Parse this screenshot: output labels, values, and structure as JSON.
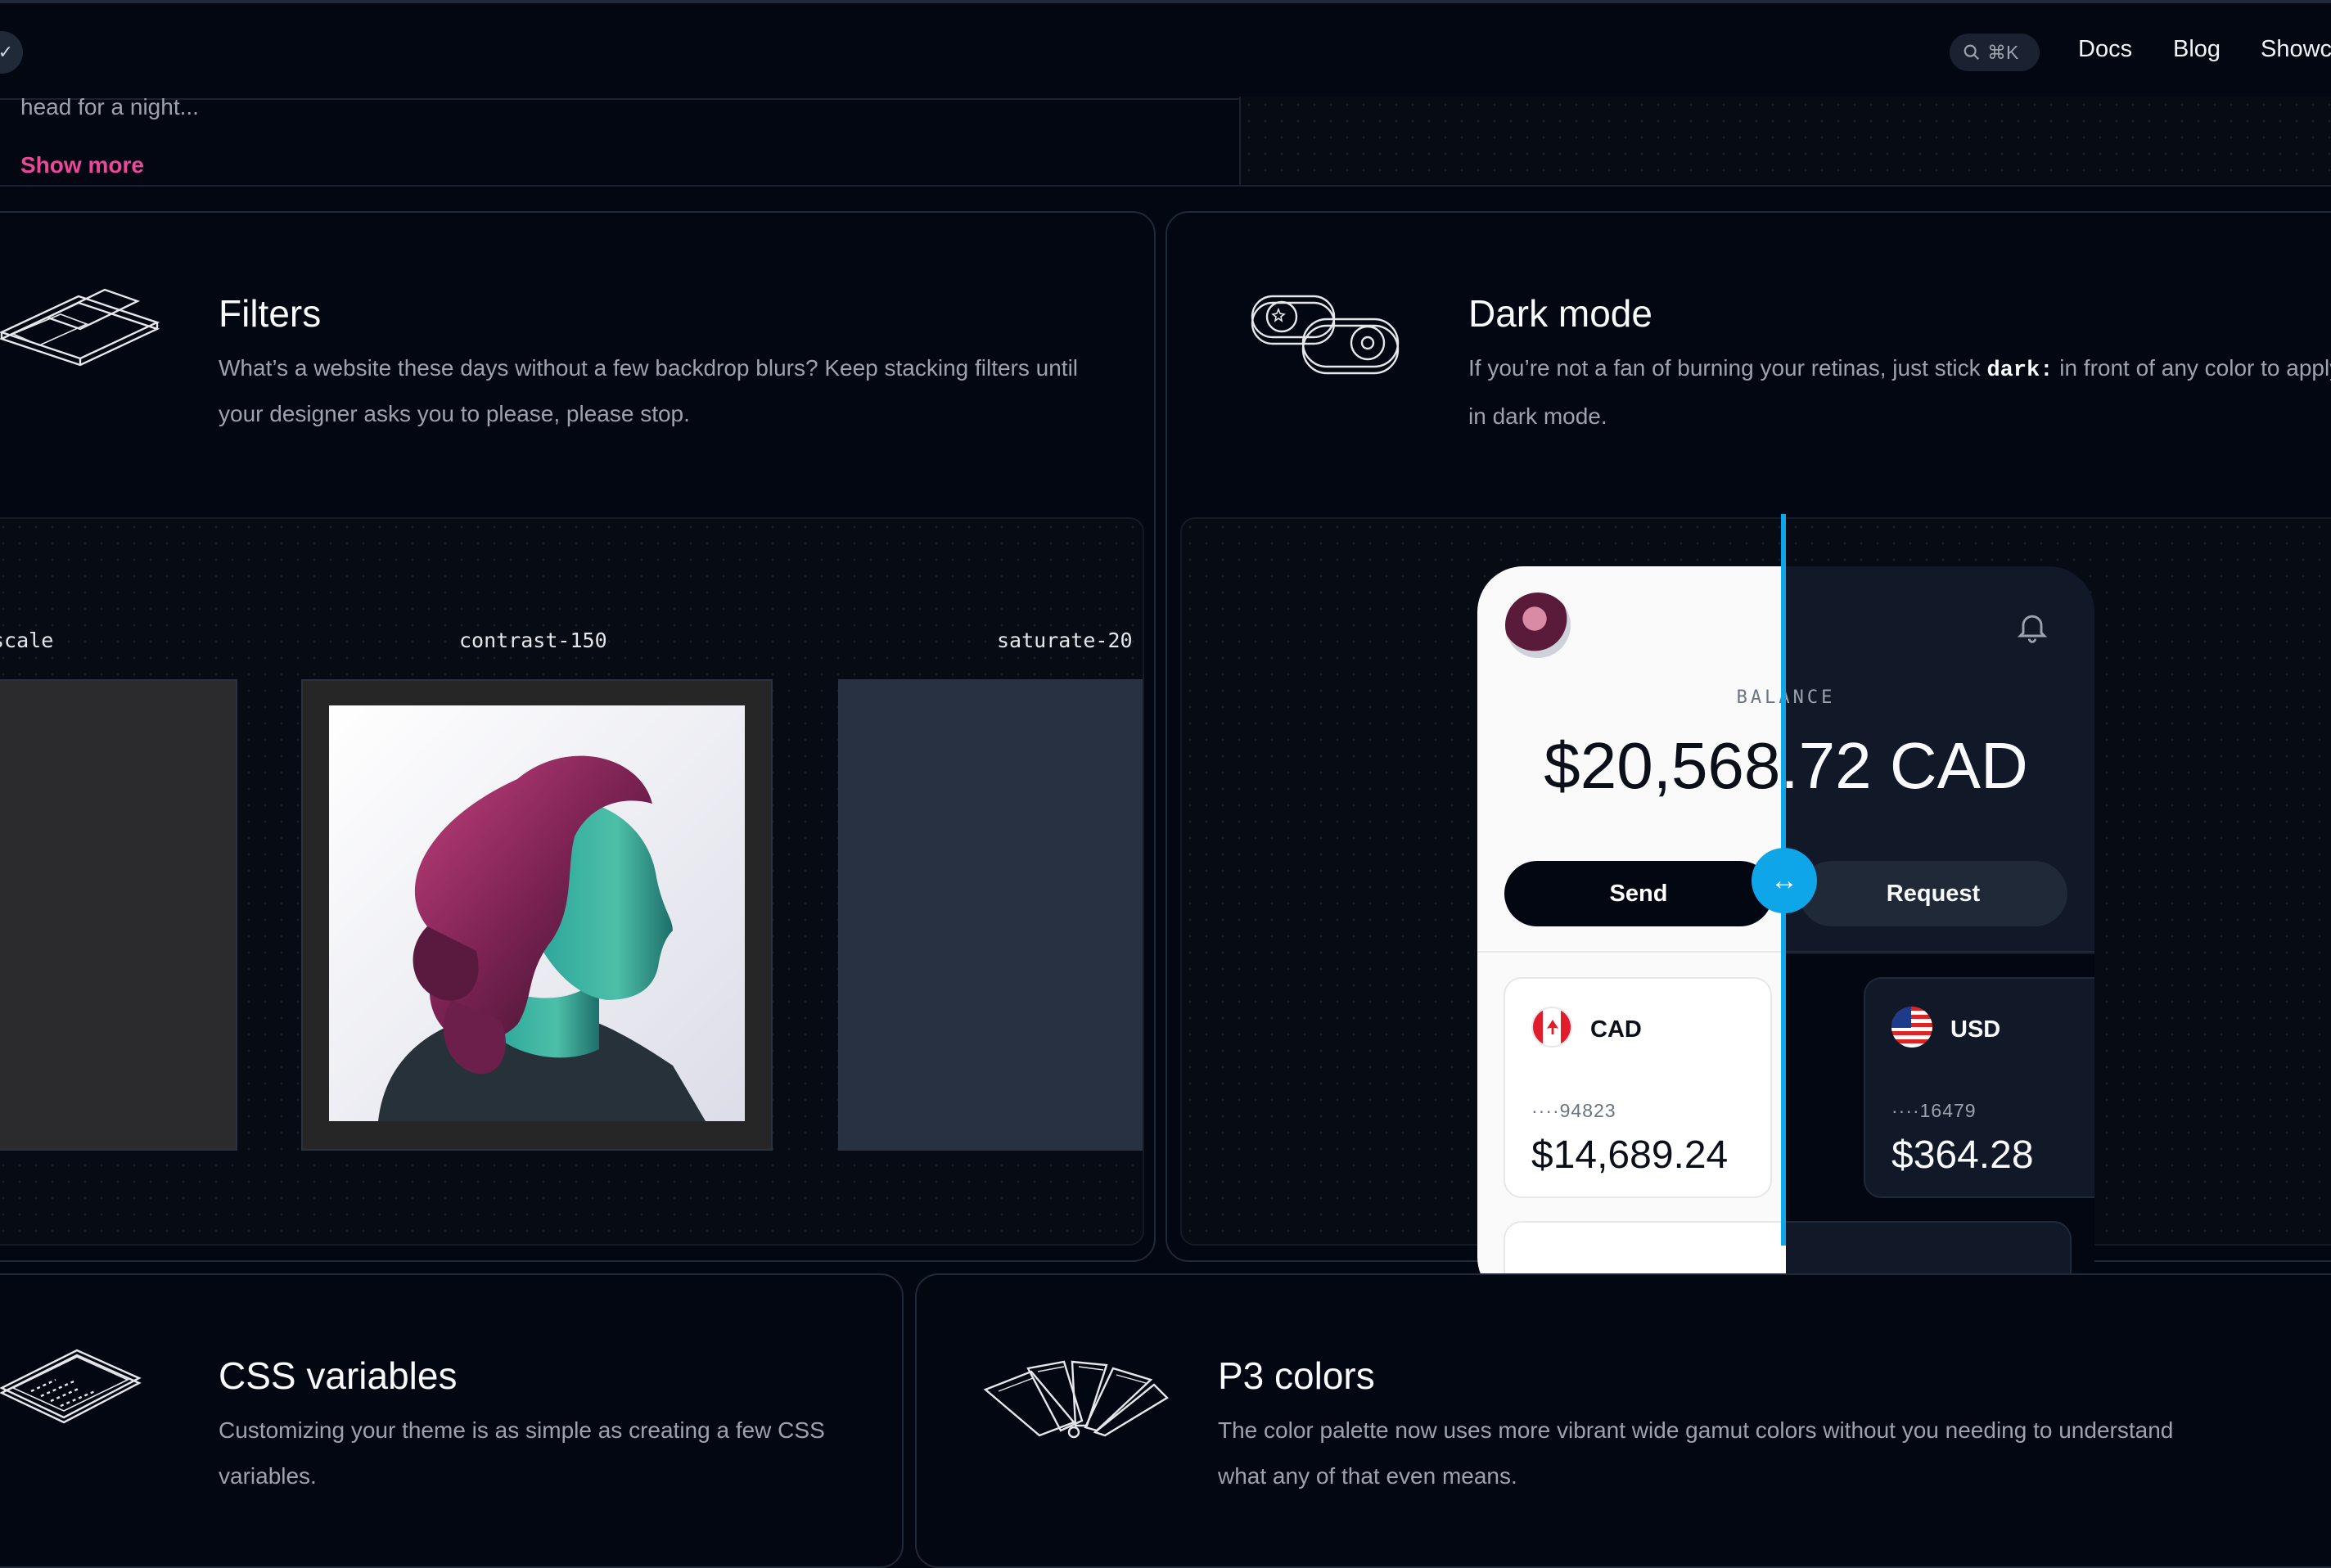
{
  "nav": {
    "search_shortcut": "⌘K",
    "links": [
      "Docs",
      "Blog",
      "Showc"
    ]
  },
  "previous_card": {
    "text": "head for a night...",
    "show_more": "Show more"
  },
  "filters": {
    "title": "Filters",
    "description": "What’s a website these days without a few backdrop blurs? Keep stacking filters until your designer asks you to please, please stop.",
    "labels": [
      "scale",
      "contrast-150",
      "saturate-20"
    ],
    "icon": "layered-panels-icon"
  },
  "dark_mode": {
    "title": "Dark mode",
    "description_before": "If you’re not a fan of burning your retinas, just stick ",
    "code": "dark:",
    "description_after": " in front of any color to apply it in dark mode.",
    "icon": "toggle-switches-icon",
    "accent": "#0ea5e9",
    "phone": {
      "balance_label": "BALANCE",
      "balance": "$20,568.72 CAD",
      "send": "Send",
      "request": "Request",
      "accounts": [
        {
          "currency": "CAD",
          "number": "····94823",
          "amount": "$14,689.24"
        },
        {
          "currency": "USD",
          "number": "····16479",
          "amount": "$364.28"
        }
      ]
    }
  },
  "css_variables": {
    "title": "CSS variables",
    "description": "Customizing your theme is as simple as creating a few CSS variables.",
    "icon": "code-tablet-icon"
  },
  "p3_colors": {
    "title": "P3 colors",
    "description": "The color palette now uses more vibrant wide gamut colors without you needing to understand what any of that even means.",
    "icon": "color-swatch-fan-icon"
  },
  "colors": {
    "background": "#030712",
    "accent_pink": "#ec4899",
    "accent_blue": "#0ea5e9"
  }
}
